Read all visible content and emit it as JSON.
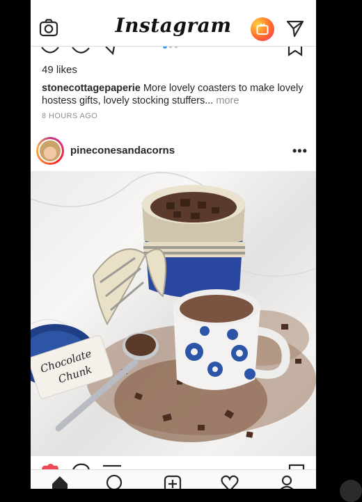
{
  "header": {
    "logo": "Instagram",
    "camera_icon": "camera-icon",
    "igtv_icon": "igtv-icon",
    "direct_icon": "direct-message-icon"
  },
  "previous_post": {
    "likes": "49 likes",
    "username": "stonecottagepaperie",
    "caption": " More lovely coasters to make lovely hostess gifts, lovely stocking stuffers...",
    "more_label": " more",
    "time_ago": "8 HOURS AGO"
  },
  "post": {
    "username": "pineconesandacorns",
    "more_icon": "ellipsis-icon",
    "tag_text_line1": "Chocolate",
    "tag_text_line2": "Chunk"
  },
  "tabbar": {
    "items": [
      "home-icon",
      "search-icon",
      "new-post-icon",
      "activity-heart-icon",
      "profile-icon"
    ]
  },
  "colors": {
    "gradient_start": "#ffd23a",
    "gradient_end": "#f5306f",
    "text": "#262626",
    "muted": "#8e8e8e",
    "carousel_active": "#3897f0"
  }
}
